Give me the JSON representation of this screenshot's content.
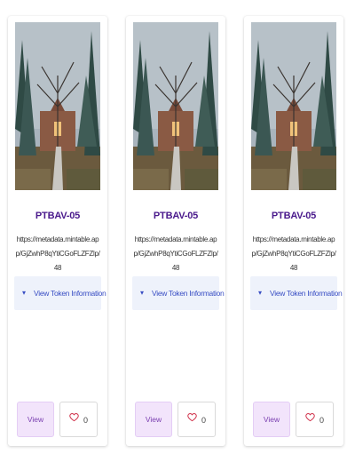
{
  "cards": [
    {
      "title": "PTBAV-05",
      "url": "https://metadata.mintable.app/GjZwhP8qYtiCGoFLZFZlp/48",
      "token_info_label": "View Token Information",
      "view_label": "View",
      "likes": "0",
      "image_icon": "campus-path-photo"
    },
    {
      "title": "PTBAV-05",
      "url": "https://metadata.mintable.app/GjZwhP8qYtiCGoFLZFZlp/48",
      "token_info_label": "View Token Information",
      "view_label": "View",
      "likes": "0",
      "image_icon": "campus-path-photo"
    },
    {
      "title": "PTBAV-05",
      "url": "https://metadata.mintable.app/GjZwhP8qYtiCGoFLZFZlp/48",
      "token_info_label": "View Token Information",
      "view_label": "View",
      "likes": "0",
      "image_icon": "campus-path-photo"
    }
  ],
  "icons": {
    "expand": "chevron-down-icon",
    "like": "heart-outline-icon"
  },
  "colors": {
    "title": "#4a1a8c",
    "link": "#3a4fc4",
    "view_bg": "#f2e4fb",
    "token_bg": "#eef2fb",
    "heart": "#d0304a"
  }
}
